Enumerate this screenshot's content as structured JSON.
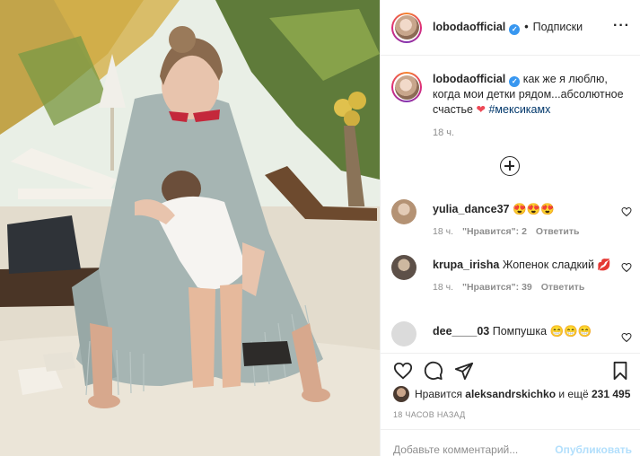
{
  "header": {
    "username": "lobodaofficial",
    "verified_mark": "✓",
    "separator": "•",
    "follow_label": "Подписки",
    "more_label": "···"
  },
  "caption": {
    "username": "lobodaofficial",
    "text": "как же я люблю, когда мои детки рядом...абсолютное счастье",
    "heart": "❤",
    "hashtag": "#мексикамх",
    "time": "18 ч."
  },
  "load_more": {
    "icon": "plus-circle-icon"
  },
  "comments": [
    {
      "username": "yulia_dance37",
      "text": "😍😍😍",
      "time": "18 ч.",
      "likes": "\"Нравится\": 2",
      "reply": "Ответить",
      "avatar_color": "#c9b59a"
    },
    {
      "username": "krupa_irisha",
      "text": "Жопенок сладкий 💋",
      "time": "18 ч.",
      "likes": "\"Нравится\": 39",
      "reply": "Ответить",
      "avatar_color": "#7b6d60"
    },
    {
      "username": "dee____03",
      "text": "Помпушка 😁😁😁",
      "avatar_color": "#dbdbdb"
    }
  ],
  "actions": {
    "like_icon": "heart-icon",
    "comment_icon": "comment-icon",
    "share_icon": "share-icon",
    "save_icon": "bookmark-icon"
  },
  "likes": {
    "prefix": "Нравится",
    "user": "aleksandrskichko",
    "middle": "и ещё",
    "count": "231 495"
  },
  "posted_time": "18 ЧАСОВ НАЗАД",
  "add_comment": {
    "placeholder": "Добавьте комментарий...",
    "publish_label": "Опубликовать"
  },
  "colors": {
    "accent": "#3897f0",
    "secondary_text": "#8e8e8e",
    "heart": "#ed4956",
    "publish_disabled": "#b2dffc"
  }
}
